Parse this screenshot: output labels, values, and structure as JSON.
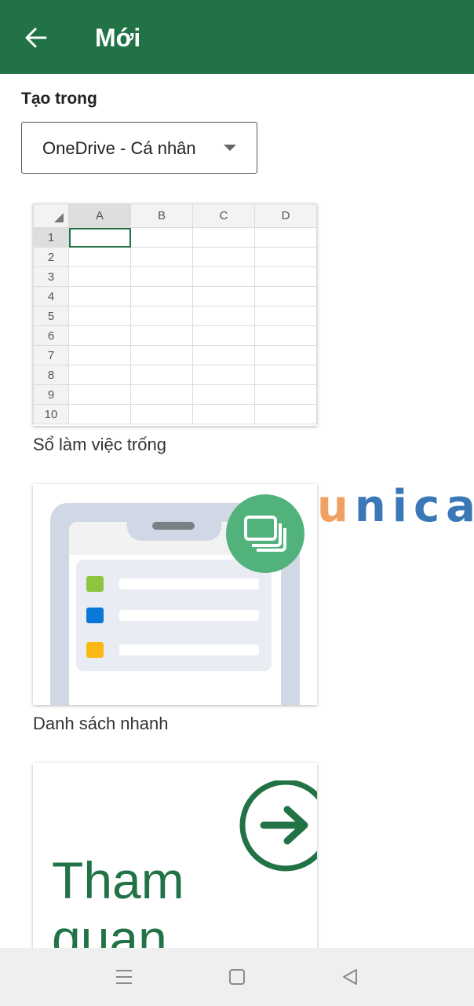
{
  "appbar": {
    "title": "Mới",
    "back_icon": "arrow-left-icon",
    "color": "#217346"
  },
  "create_in": {
    "label": "Tạo trong",
    "selected": "OneDrive - Cá nhân"
  },
  "templates": [
    {
      "label": "Sổ làm việc trống",
      "columns": [
        "A",
        "B",
        "C",
        "D"
      ],
      "rows": [
        "1",
        "2",
        "3",
        "4",
        "5",
        "6",
        "7",
        "8",
        "9",
        "10"
      ]
    },
    {
      "label": "Danh sách nhanh",
      "dot_colors": [
        "#8cc63f",
        "#0a78d7",
        "#fbb813"
      ]
    },
    {
      "title_lines": [
        "Tham",
        "quan"
      ]
    }
  ],
  "watermark": {
    "first": "u",
    "rest": "nica"
  },
  "nav": {
    "menu_icon": "menu-icon",
    "home_icon": "home-square-icon",
    "back_icon": "back-triangle-icon"
  }
}
